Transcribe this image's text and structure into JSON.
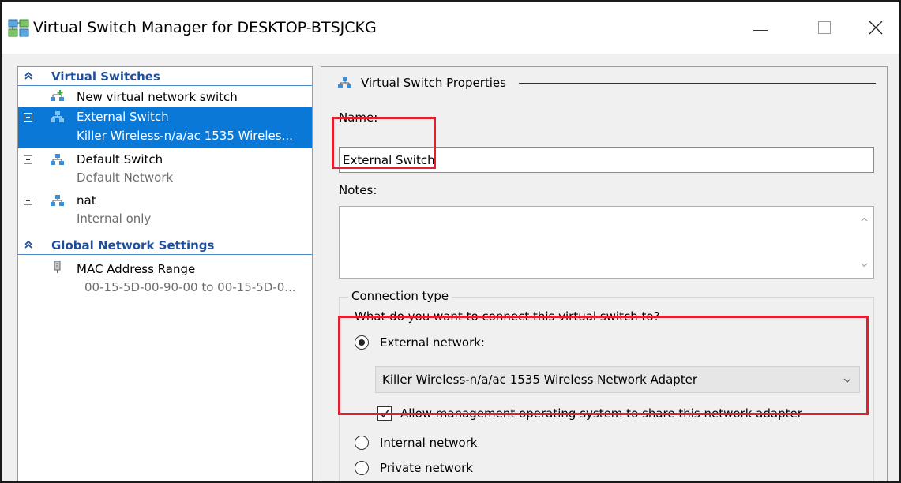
{
  "window": {
    "title": "Virtual Switch Manager for DESKTOP-BTSJCKG"
  },
  "tree": {
    "virtual_switches_header": "Virtual Switches",
    "new_switch": "New virtual network switch",
    "switches": [
      {
        "name": "External Switch",
        "detail": "Killer Wireless-n/a/ac 1535 Wireles..."
      },
      {
        "name": "Default Switch",
        "detail": "Default Network"
      },
      {
        "name": "nat",
        "detail": "Internal only"
      }
    ],
    "global_header": "Global Network Settings",
    "mac_range": {
      "name": "MAC Address Range",
      "detail": "00-15-5D-00-90-00 to 00-15-5D-0..."
    }
  },
  "properties": {
    "group_title": "Virtual Switch Properties",
    "name_label": "Name:",
    "name_value": "External Switch",
    "notes_label": "Notes:",
    "connection_type_label": "Connection type",
    "connection_question": "What do you want to connect this virtual switch to?",
    "external_network_label": "External network:",
    "adapter_selected": "Killer Wireless-n/a/ac 1535 Wireless Network Adapter",
    "allow_management_label": "Allow management operating system to share this network adapter",
    "allow_management_checked": true,
    "internal_network_label": "Internal network",
    "private_network_label": "Private network",
    "selected_connection": "External network"
  },
  "colors": {
    "selection": "#0a78d7",
    "section_header": "#1f4f9a",
    "highlight": "#e0202e"
  }
}
